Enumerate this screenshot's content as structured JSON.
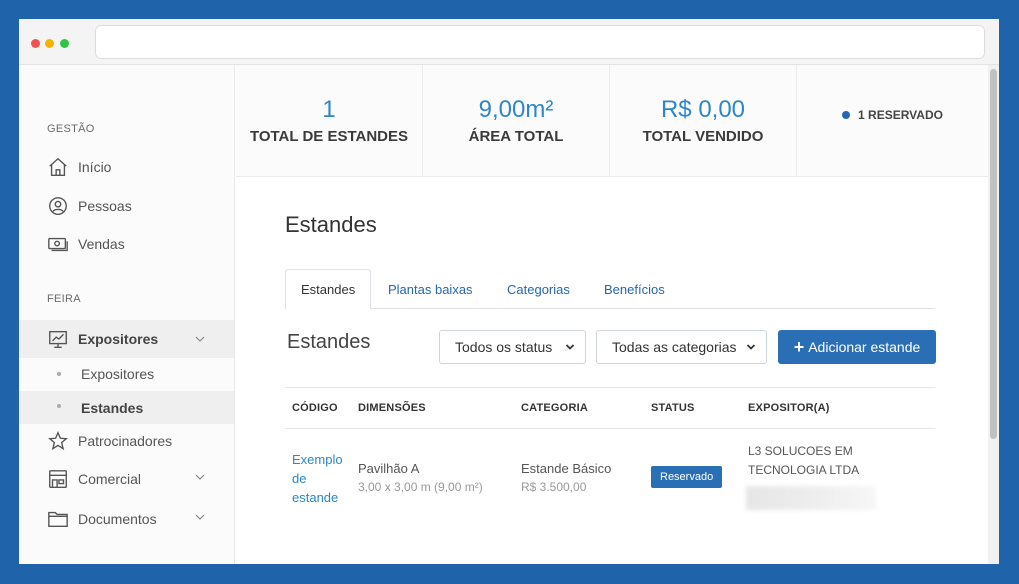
{
  "sidebar": {
    "section_gestao": "GESTÃO",
    "section_feira": "FEIRA",
    "items": {
      "inicio": "Início",
      "pessoas": "Pessoas",
      "vendas": "Vendas",
      "expositores": "Expositores",
      "sub_expositores": "Expositores",
      "sub_estandes": "Estandes",
      "patrocinadores": "Patrocinadores",
      "comercial": "Comercial",
      "documentos": "Documentos"
    }
  },
  "stats": {
    "total_estandes_value": "1",
    "total_estandes_label": "TOTAL DE ESTANDES",
    "area_total_value": "9,00m²",
    "area_total_label": "ÁREA TOTAL",
    "total_vendido_value": "R$ 0,00",
    "total_vendido_label": "TOTAL VENDIDO",
    "reservado": "1 RESERVADO"
  },
  "page": {
    "title": "Estandes",
    "tabs": [
      "Estandes",
      "Plantas baixas",
      "Categorias",
      "Benefícios"
    ],
    "section_title": "Estandes",
    "status_filter": "Todos os status",
    "category_filter": "Todas as categorias",
    "add_button": "Adicionar estande"
  },
  "table": {
    "headers": [
      "CÓDIGO",
      "DIMENSÕES",
      "CATEGORIA",
      "STATUS",
      "EXPOSITOR(A)"
    ],
    "rows": [
      {
        "codigo": "Exemplo de estande",
        "dim_title": "Pavilhão A",
        "dim_detail": "3,00 x 3,00 m (9,00 m²)",
        "categoria": "Estande Básico",
        "preco": "R$ 3.500,00",
        "status": "Reservado",
        "expositor": "L3 SOLUCOES EM TECNOLOGIA LTDA"
      }
    ]
  },
  "colors": {
    "background": "#1f64aa",
    "accent": "#2e86c9",
    "button": "#2a6fb5"
  }
}
